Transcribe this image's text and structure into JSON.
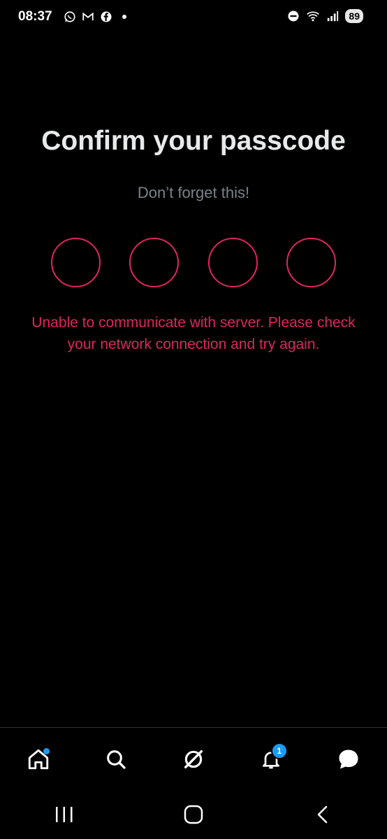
{
  "status_bar": {
    "time": "08:37",
    "battery": "89",
    "left_icons": [
      "whatsapp-icon",
      "gmail-icon",
      "facebook-icon",
      "dot-icon"
    ],
    "right_icons": [
      "dnd-icon",
      "wifi-icon",
      "signal-icon"
    ]
  },
  "screen": {
    "title": "Confirm your passcode",
    "subtitle": "Don’t forget this!",
    "pin_length": 4,
    "error": "Unable to communicate with server. Please check your network connection and try again.",
    "error_color": "#e0245e"
  },
  "nav": {
    "items": [
      "home",
      "search",
      "grok",
      "notifications",
      "messages"
    ],
    "notifications_badge": "1",
    "accent": "#1d9bf0"
  },
  "system_nav": [
    "recents",
    "home",
    "back"
  ]
}
